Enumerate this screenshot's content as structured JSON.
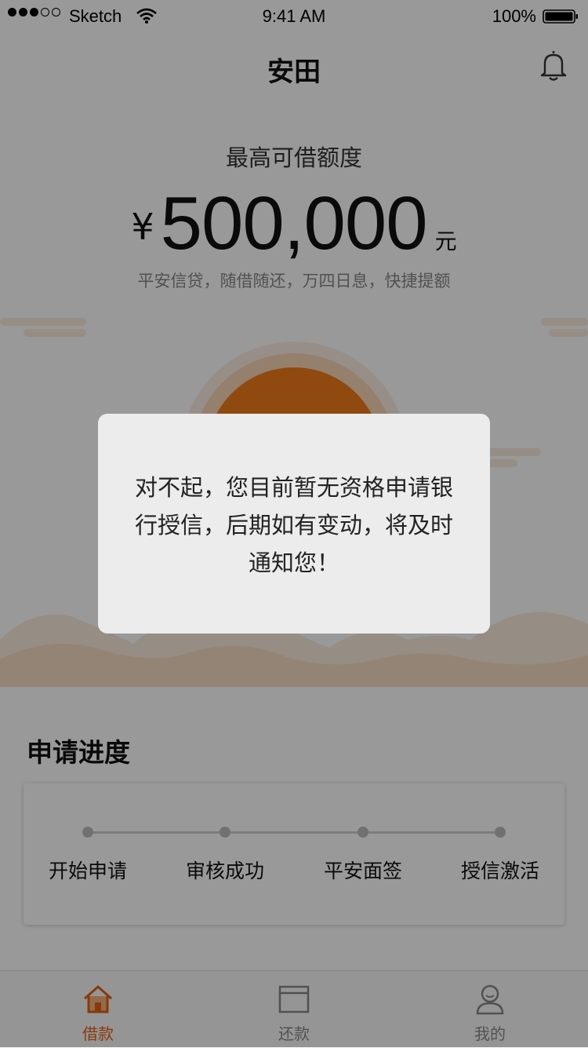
{
  "status_bar": {
    "carrier": "Sketch",
    "time": "9:41 AM",
    "battery": "100%"
  },
  "nav": {
    "title": "安田",
    "bell_icon": "bell-icon"
  },
  "hero": {
    "label": "最高可借额度",
    "currency": "¥",
    "amount": "500,000",
    "unit": "元",
    "slogan": "平安信贷，随借随还，万四日息，快捷提额"
  },
  "progress": {
    "title": "申请进度",
    "steps": [
      "开始申请",
      "审核成功",
      "平安面签",
      "授信激活"
    ]
  },
  "tabbar": {
    "tabs": [
      {
        "label": "借款",
        "icon": "home-icon",
        "active": true
      },
      {
        "label": "还款",
        "icon": "card-icon",
        "active": false
      },
      {
        "label": "我的",
        "icon": "profile-icon",
        "active": false
      }
    ]
  },
  "dialog": {
    "message": "对不起，您目前暂无资格申请银行授信，后期如有变动，将及时通知您！"
  },
  "colors": {
    "accent": "#E36010",
    "sun": "#F07A18",
    "sun_glow": "#FBE3CF",
    "mountain": "#FBEBDD",
    "overlay": "rgba(0,0,0,0.4)"
  }
}
